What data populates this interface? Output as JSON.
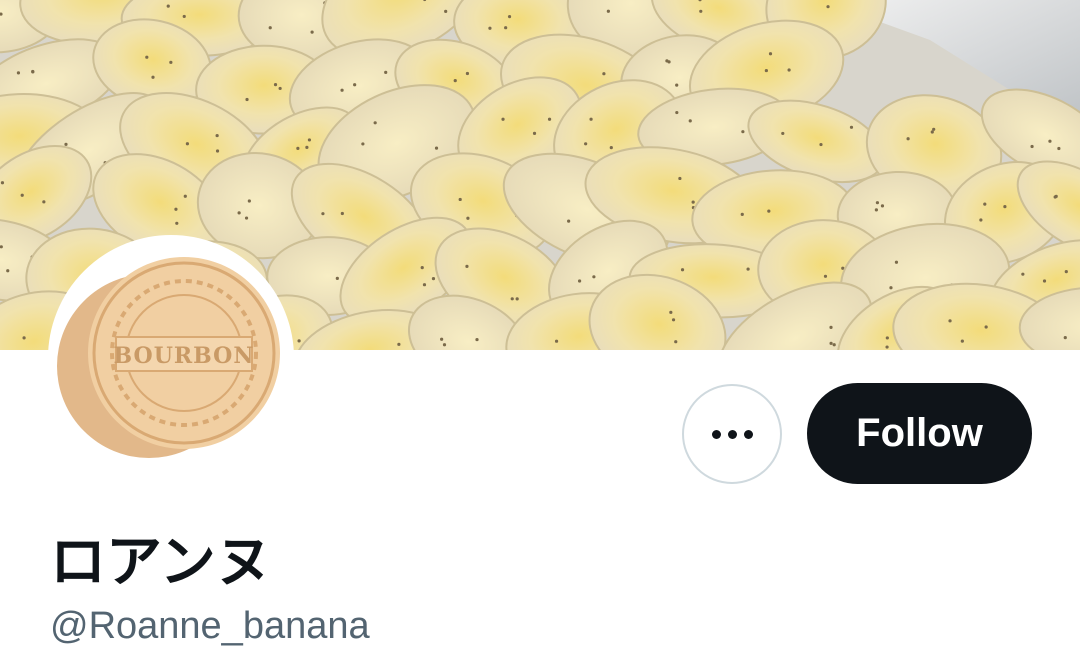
{
  "profile": {
    "display_name": "ロアンヌ",
    "handle": "@Roanne_banana",
    "avatar_text": "BOURBON"
  },
  "actions": {
    "follow_label": "Follow",
    "more_icon": "ellipsis-icon"
  },
  "colors": {
    "follow_bg": "#0f1419",
    "follow_text": "#ffffff",
    "handle_text": "#536471",
    "outline": "#cfd9de"
  }
}
